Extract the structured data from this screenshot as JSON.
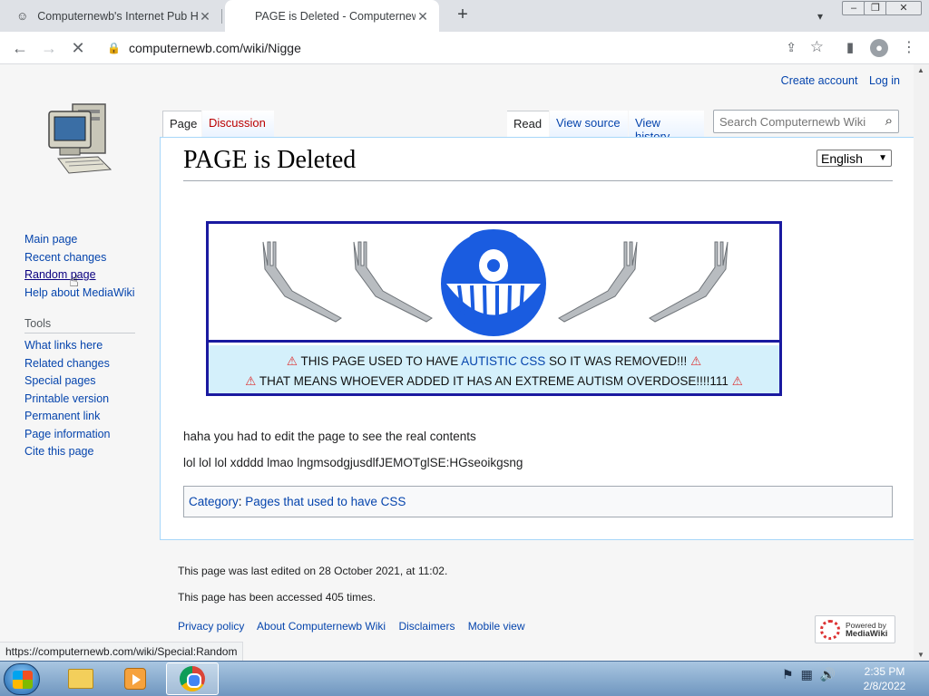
{
  "browser": {
    "tabs": [
      {
        "title": "Computernewb's Internet Pub Hu",
        "close": "✕"
      },
      {
        "title": "PAGE is Deleted - Computernewb",
        "close": "✕"
      }
    ],
    "new_tab": "+",
    "url": "computernewb.com/wiki/Nigge",
    "status_url": "https://computernewb.com/wiki/Special:Random"
  },
  "wiki": {
    "personal": {
      "create_account": "Create account",
      "log_in": "Log in"
    },
    "nav": [
      "Main page",
      "Recent changes",
      "Random page",
      "Help about MediaWiki"
    ],
    "tools_heading": "Tools",
    "tools": [
      "What links here",
      "Related changes",
      "Special pages",
      "Printable version",
      "Permanent link",
      "Page information",
      "Cite this page"
    ],
    "tabs": {
      "page": "Page",
      "discussion": "Discussion",
      "read": "Read",
      "view_source": "View source",
      "view_history": "View history"
    },
    "search_placeholder": "Search Computernewb Wiki",
    "title": "PAGE is Deleted",
    "language": "English",
    "notice": {
      "line1_before": "THIS PAGE USED TO HAVE ",
      "line1_link": "AUTISTIC CSS",
      "line1_after": " SO IT WAS REMOVED!!! ",
      "line2": "THAT MEANS WHOEVER ADDED IT HAS AN EXTREME AUTISM OVERDOSE!!!!111 "
    },
    "paragraph1": "haha you had to edit the page to see the real contents",
    "paragraph2": "lol lol lol xdddd lmao lngmsodgjusdlfJEMOTglSE:HGseoikgsng",
    "category_label": "Category",
    "category": "Pages that used to have CSS",
    "footer": {
      "edited": "This page was last edited on 28 October 2021, at 11:02.",
      "views": "This page has been accessed 405 times.",
      "links": [
        "Privacy policy",
        "About Computernewb Wiki",
        "Disclaimers",
        "Mobile view"
      ],
      "powered_by": "Powered by",
      "powered_name": "MediaWiki"
    }
  },
  "taskbar": {
    "time": "2:35 PM",
    "date": "2/8/2022"
  }
}
